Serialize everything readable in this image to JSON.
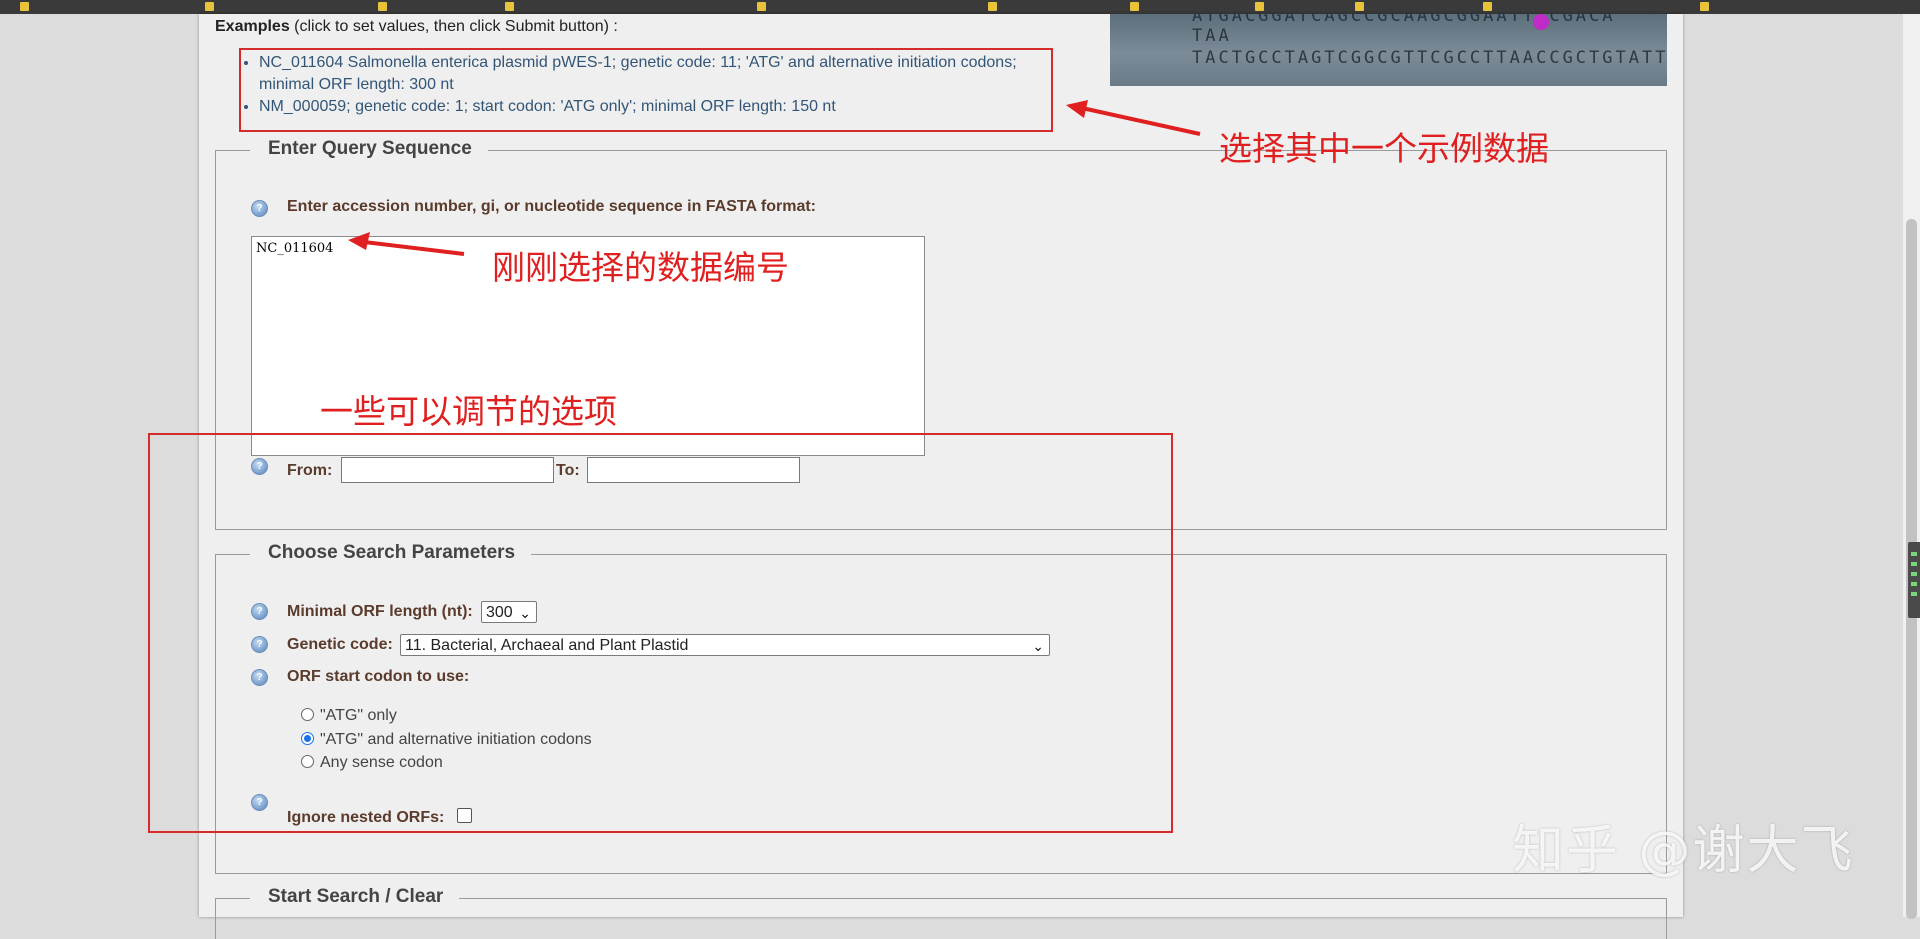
{
  "examples": {
    "title_bold": "Examples",
    "title_rest": " (click to set values, then click Submit button) :",
    "items": [
      "NC_011604 Salmonella enterica plasmid pWES-1; genetic code: 11; 'ATG' and alternative initiation codons; minimal ORF length: 300 nt",
      "NM_000059; genetic code: 1; start codon: 'ATG only'; minimal ORF length: 150 nt"
    ]
  },
  "dna_image": {
    "row1": "ATGACGGATCAGCCGCAAGCGGAATT CGACA TAA",
    "row2": "TACTGCCTAGTCGGCGTTCGCCTTAACCGCTGTATT"
  },
  "query": {
    "legend": "Enter Query Sequence",
    "label": "Enter accession number, gi, or nucleotide sequence in FASTA format:",
    "value": "NC_011604",
    "from_label": "From:",
    "to_label": "To:",
    "from_value": "",
    "to_value": ""
  },
  "params": {
    "legend": "Choose Search Parameters",
    "min_orf_label": "Minimal ORF length (nt):",
    "min_orf_value": "300",
    "genetic_code_label": "Genetic code:",
    "genetic_code_value": "11. Bacterial, Archaeal and Plant Plastid",
    "start_codon_label": "ORF start codon to use:",
    "start_codon_options": [
      "\"ATG\" only",
      "\"ATG\" and alternative initiation codons",
      "Any sense codon"
    ],
    "start_codon_selected": 1,
    "ignore_nested_label": "Ignore nested ORFs:",
    "ignore_nested_checked": false
  },
  "search": {
    "legend": "Start Search / Clear"
  },
  "annotations": {
    "pick_example": "选择其中一个示例数据",
    "selected_id": "刚刚选择的数据编号",
    "options": "一些可以调节的选项"
  },
  "watermark": "知乎 @谢大飞",
  "colors": {
    "annotation_red": "#e02020",
    "panel_bg": "#efefef",
    "label_brown": "#5a3b2c",
    "link_blue": "#335577"
  }
}
